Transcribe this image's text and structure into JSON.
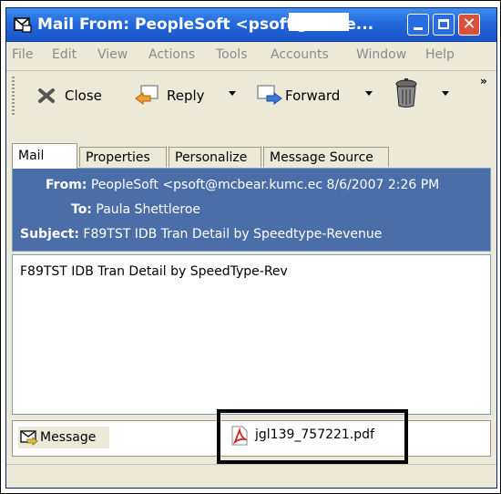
{
  "window": {
    "title": "Mail From: PeopleSoft <psoft@mcbe..."
  },
  "menu": [
    "File",
    "Edit",
    "View",
    "Actions",
    "Tools",
    "Accounts",
    "Window",
    "Help"
  ],
  "toolbar": {
    "close_label": "Close",
    "reply_label": "Reply",
    "forward_label": "Forward",
    "overflow": "»"
  },
  "tabs": [
    "Mail",
    "Properties",
    "Personalize",
    "Message Source"
  ],
  "header": {
    "from_label": "From:",
    "from_value": "PeopleSoft <psoft@mcbear.kumc.ec 8/6/2007 2:26 PM",
    "to_label": "To:",
    "to_value": "Paula Shettleroe",
    "subject_label": "Subject:",
    "subject_value": "F89TST  IDB Tran Detail by Speedtype-Revenue"
  },
  "body": {
    "text": "F89TST  IDB Tran Detail by SpeedType-Rev"
  },
  "attachments": {
    "message_label": "Message",
    "file_name": "jgl139_757221.pdf"
  },
  "colors": {
    "title_bar": "#2468dc",
    "header_panel": "#4a6ea8",
    "window_bg": "#ece9d8"
  }
}
